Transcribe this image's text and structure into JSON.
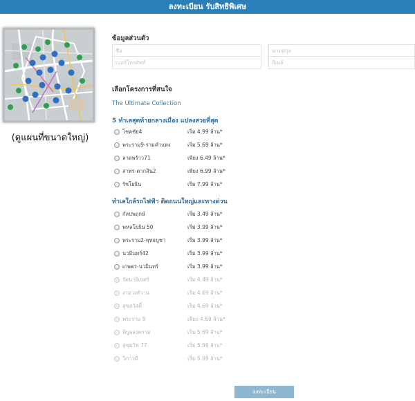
{
  "header": {
    "title": "ลงทะเบียน รับสิทธิพิเศษ"
  },
  "map": {
    "caption": "(ดูแผนที่ขนาดใหญ่)"
  },
  "personal": {
    "title": "ข้อมูลส่วนตัว",
    "first_name_placeholder": "ชื่อ",
    "last_name_placeholder": "นามสกุล",
    "phone_placeholder": "เบอร์โทรศัพท์",
    "email_placeholder": "อีเมล์"
  },
  "projects": {
    "title": "เลือกโครงการที่สนใจ",
    "collection": "The Ultimate Collection",
    "groups": [
      {
        "title": "5 ทำเลสุดท้ายกลางเมือง แปลงสวยที่สุด",
        "items": [
          {
            "name": "โชคชัย4",
            "price": "เริ่ม 4.99 ล้าน*",
            "enabled": true
          },
          {
            "name": "พระราม9-รามคำแหง",
            "price": "เริ่ม 5.69 ล้าน*",
            "enabled": true
          },
          {
            "name": "ลาดพร้าว71",
            "price": "เพียง 6.49 ล้าน*",
            "enabled": true
          },
          {
            "name": "สาทร-ตากสิน2",
            "price": "เพียง 6.99 ล้าน*",
            "enabled": true
          },
          {
            "name": "รัชโยธิน",
            "price": "เริ่ม 7.99 ล้าน*",
            "enabled": true
          }
        ]
      },
      {
        "title": "ทำเลใกล้รถไฟฟ้า ติดถนนใหญ่และทางด่วน",
        "items": [
          {
            "name": "กัลปพฤกษ์",
            "price": "เริ่ม 3.49 ล้าน*",
            "enabled": true
          },
          {
            "name": "พหลโยธิน 50",
            "price": "เริ่ม 3.99 ล้าน*",
            "enabled": true
          },
          {
            "name": "พระราม2-พุทธบูชา",
            "price": "เริ่ม 3.99 ล้าน*",
            "enabled": true
          },
          {
            "name": "นวมินทร์42",
            "price": "เริ่ม 3.99 ล้าน*",
            "enabled": true
          },
          {
            "name": "เกษตร-นวมินทร์",
            "price": "เริ่ม 3.99 ล้าน*",
            "enabled": true
          },
          {
            "name": "รัตนาธิเบศร์",
            "price": "เริ่ม 4.49 ล้าน*",
            "enabled": false
          },
          {
            "name": "งามวงศ์วาน",
            "price": "เริ่ม 4.69 ล้าน*",
            "enabled": false
          },
          {
            "name": "สุขสวัสดิ์",
            "price": "เริ่ม 4.69 ล้าน*",
            "enabled": false
          },
          {
            "name": "พระราม 9",
            "price": "เพียง 4.69 ล้าน*",
            "enabled": false
          },
          {
            "name": "พิบูลสงคราม",
            "price": "เริ่ม 5.69 ล้าน*",
            "enabled": false
          },
          {
            "name": "สุขุมวิท 77",
            "price": "เริ่ม 5.99 ล้าน*",
            "enabled": false
          },
          {
            "name": "วิภาวดี",
            "price": "เริ่ม 5.99 ล้าน*",
            "enabled": false
          }
        ]
      }
    ]
  },
  "submit": {
    "label": "ลงทะเบียน"
  },
  "colors": {
    "header": "#2b7fb8",
    "link": "#2b7fb8",
    "group_title": "#2b6fa3",
    "submit": "#8fb6d3"
  }
}
